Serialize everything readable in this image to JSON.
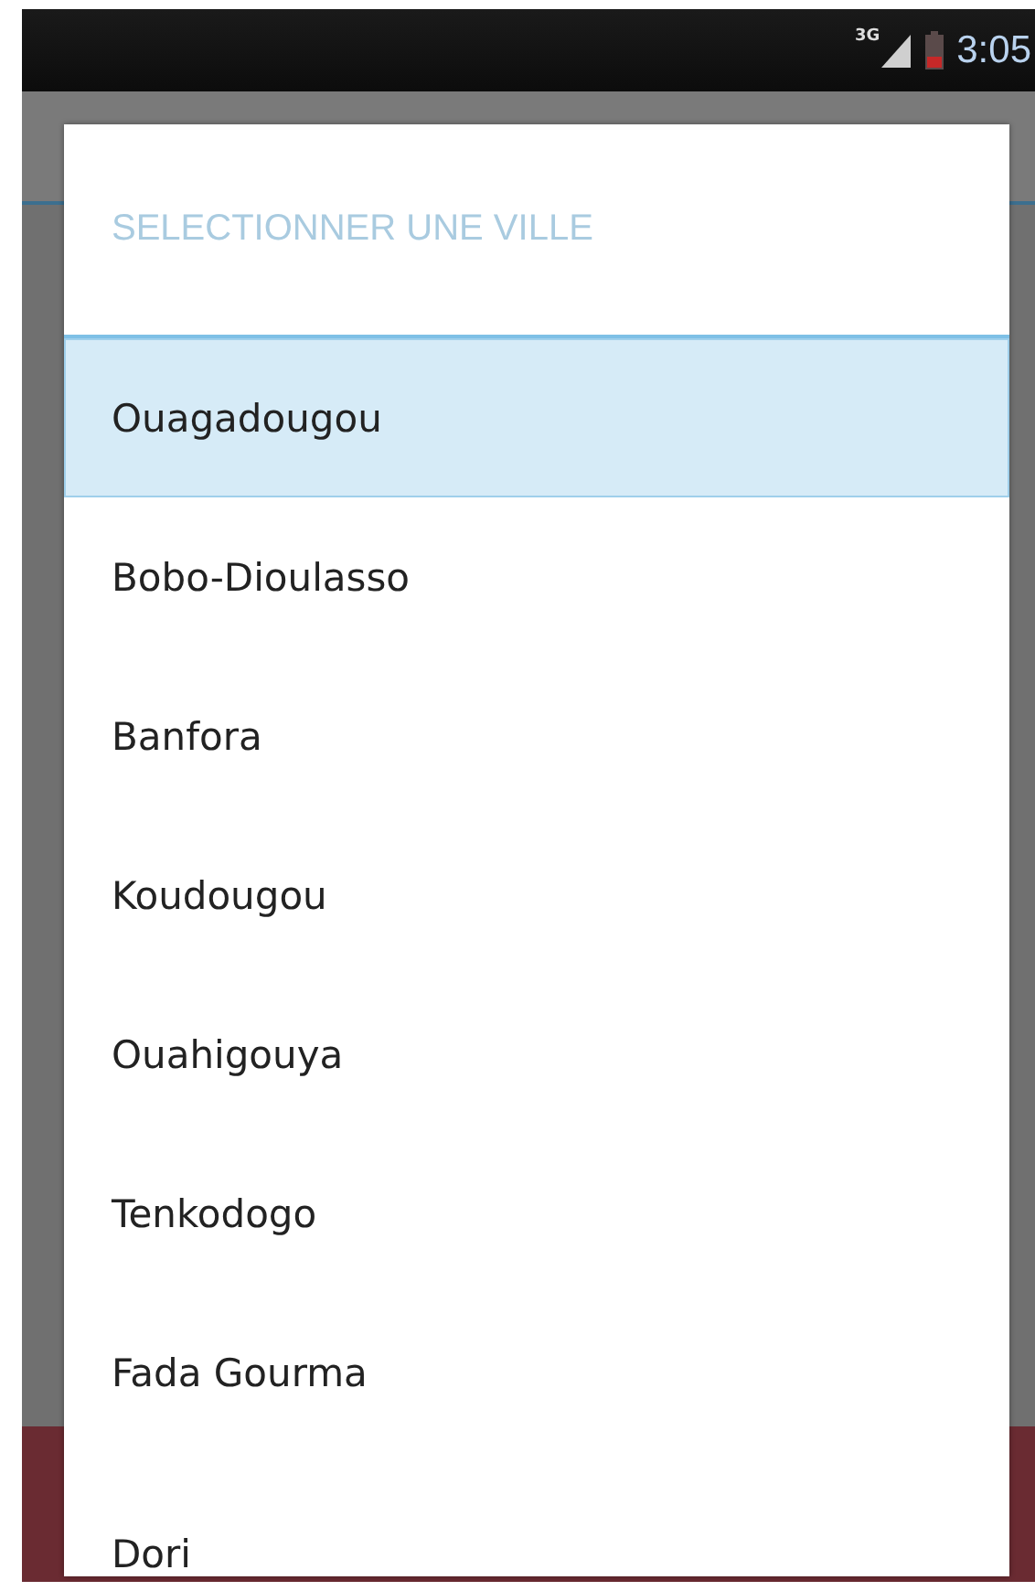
{
  "status_bar": {
    "network": "3G",
    "time": "3:05"
  },
  "dialog": {
    "title": "SELECTIONNER UNE VILLE",
    "items": [
      {
        "label": "Ouagadougou",
        "selected": true
      },
      {
        "label": "Bobo-Dioulasso",
        "selected": false
      },
      {
        "label": "Banfora",
        "selected": false
      },
      {
        "label": "Koudougou",
        "selected": false
      },
      {
        "label": "Ouahigouya",
        "selected": false
      },
      {
        "label": "Tenkodogo",
        "selected": false
      },
      {
        "label": "Fada Gourma",
        "selected": false
      },
      {
        "label": "Dori",
        "selected": false
      }
    ]
  }
}
